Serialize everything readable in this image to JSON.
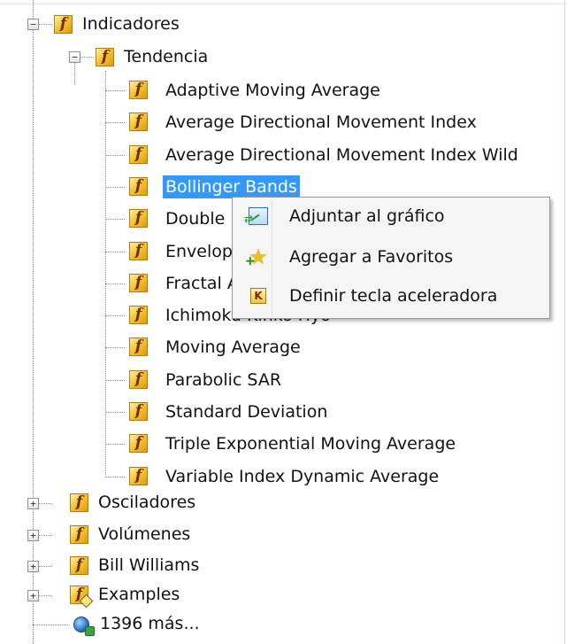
{
  "tree": {
    "root": {
      "label": "Indicadores",
      "icon": "function-icon",
      "expander": "−"
    },
    "group": {
      "label": "Tendencia",
      "icon": "function-icon",
      "expander": "−"
    },
    "items": [
      {
        "label": "Adaptive Moving Average"
      },
      {
        "label": "Average Directional Movement Index"
      },
      {
        "label": "Average Directional Movement Index Wild"
      },
      {
        "label": "Bollinger Bands",
        "selected": true
      },
      {
        "label": "Double Exponential Moving Average"
      },
      {
        "label": "Envelopes"
      },
      {
        "label": "Fractal Adaptive Moving Average"
      },
      {
        "label": "Ichimoku Kinko Hyo"
      },
      {
        "label": "Moving Average"
      },
      {
        "label": "Parabolic SAR"
      },
      {
        "label": "Standard Deviation"
      },
      {
        "label": "Triple Exponential Moving Average"
      },
      {
        "label": "Variable Index Dynamic Average"
      }
    ],
    "siblings": [
      {
        "label": "Osciladores",
        "expander": "+"
      },
      {
        "label": "Volúmenes",
        "expander": "+"
      },
      {
        "label": "Bill Williams",
        "expander": "+"
      },
      {
        "label": "Examples",
        "expander": "+"
      }
    ],
    "more": {
      "label": "1396 más...",
      "icon": "globe-download-icon"
    }
  },
  "context_menu": {
    "items": [
      {
        "label": "Adjuntar al gráfico",
        "icon": "attach-chart-icon"
      },
      {
        "label": "Agregar a Favoritos",
        "icon": "add-favorite-star-icon"
      },
      {
        "label": "Definir tecla aceleradora",
        "icon": "hotkey-icon",
        "glyph": "K"
      }
    ]
  },
  "colors": {
    "selection": "#3399ff",
    "icon_yellow": "#f6c530"
  }
}
